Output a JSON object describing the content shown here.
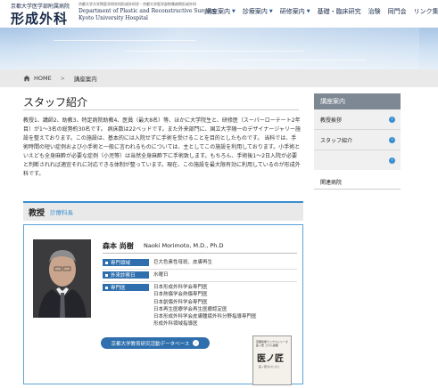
{
  "header": {
    "logo_small": "京都大学医学部附属病院",
    "logo_en_top": "京都大学大学院医学研究科形成外科学・京都大学医学部附属病院形成外科",
    "logo_main": "形成外科",
    "logo_en_line1": "Department of Plastic and Reconstructive Surgery,",
    "logo_en_line2": "Kyoto University Hospital",
    "nav": [
      {
        "label": "講座案内",
        "has_menu": true
      },
      {
        "label": "診療案内",
        "has_menu": true
      },
      {
        "label": "研修案内",
        "has_menu": true
      },
      {
        "label": "基礎・臨床研究",
        "has_menu": false
      },
      {
        "label": "治験",
        "has_menu": false
      },
      {
        "label": "同門会",
        "has_menu": false
      },
      {
        "label": "リンク集",
        "has_menu": false
      }
    ]
  },
  "breadcrumb": {
    "home": "HOME",
    "current": "講座案内"
  },
  "page": {
    "title": "スタッフ紹介",
    "intro": "教授1、講師2、助教3、特定病院助教4、医員（最大8名）等、ほかに大学院生と、研修医（スーパーローテート2年目）が1～3名の総勢約30名です。 病床数は22ベッドです。また外来部門に、国立大学随一のデザイナージャリー施設を整えております。この施設は、基本的には入院せずに手術を受けることを目的としたものです。 当科では、手術時間の短い症例および小手術と一般に言われるものについては、主としてこの施設を利用しております。小手術といえども全身麻酔が必要な症例（小児等）は当然全身麻酔下に手術致します。もちろん、手術後1～2日入院が必要と判断されれば適宜それに対応できる体制が整っています。現在、この施設を最大限有効に利用しているのが形成外科です。"
  },
  "section": {
    "title": "教授",
    "subtitle": "診療科長"
  },
  "profile": {
    "name_jp": "森本 尚樹",
    "name_en": "Naoki Morimoto, M.D., Ph.D",
    "rows": [
      {
        "label": "専門領域",
        "lines": [
          "巨大色素性母斑、皮膚再生"
        ]
      },
      {
        "label": "外来診察日",
        "lines": [
          "水曜日"
        ]
      },
      {
        "label": "専門医",
        "lines": [
          "日本形成外科学会専門医",
          "日本熱傷学会熱傷専門医",
          "日本創傷外科学会専門医",
          "日本再生医療学会再生医療認定医",
          "日本形成外科学会皮膚腫瘍外科分野指導専門医",
          "形成外科領域指導医"
        ]
      }
    ],
    "db_button": "京都大学教育研究活動データベース",
    "book": {
      "top": "京都新聞ブックスシリーズ 医ノ匠 コラム連載",
      "title": "医ノ匠",
      "sub": "医ノ匠のひとびと"
    }
  },
  "sidebar": {
    "heading": "講座案内",
    "items": [
      {
        "label": "教授挨拶"
      },
      {
        "label": "スタッフ紹介"
      },
      {
        "label": ""
      }
    ],
    "related": "関連病院"
  },
  "colors": {
    "accent": "#3a8ed0",
    "navy": "#2f6fae",
    "sidebar_head": "#7d8894",
    "brand": "#1a2b4a"
  }
}
